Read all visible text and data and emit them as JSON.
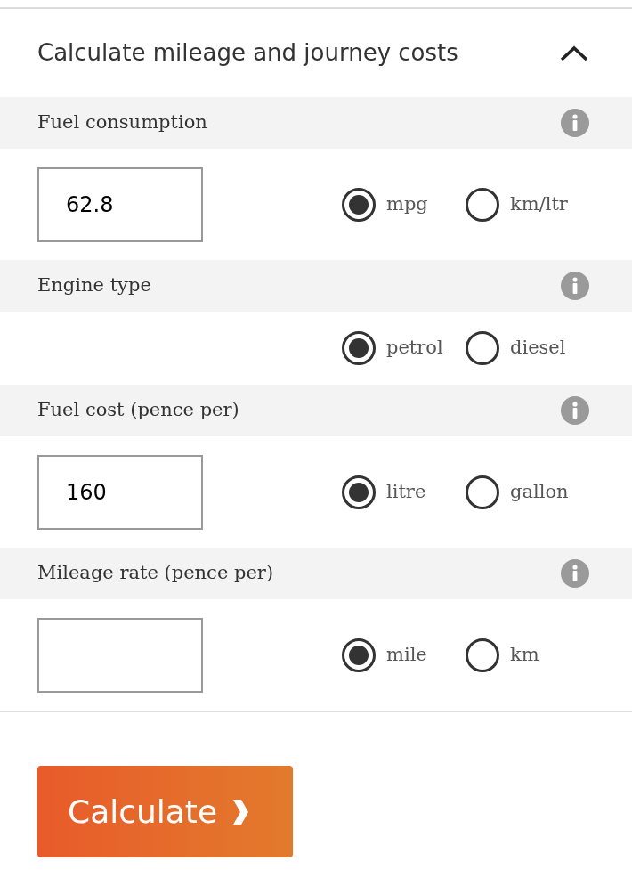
{
  "panel": {
    "title": "Calculate mileage and journey costs",
    "expanded": true
  },
  "sections": [
    {
      "kind": "input",
      "label": "Fuel consumption",
      "value": "62.8",
      "options": [
        {
          "label": "mpg",
          "selected": true
        },
        {
          "label": "km/ltr",
          "selected": false
        }
      ]
    },
    {
      "kind": "radio",
      "label": "Engine type",
      "options": [
        {
          "label": "petrol",
          "selected": true
        },
        {
          "label": "diesel",
          "selected": false
        }
      ]
    },
    {
      "kind": "input",
      "label": "Fuel cost (pence per)",
      "value": "160",
      "options": [
        {
          "label": "litre",
          "selected": true
        },
        {
          "label": "gallon",
          "selected": false
        }
      ]
    },
    {
      "kind": "input",
      "label": "Mileage rate (pence per)",
      "options": [
        {
          "label": "mile",
          "selected": true
        },
        {
          "label": "km",
          "selected": false
        }
      ]
    }
  ],
  "button": {
    "label": "Calculate"
  }
}
